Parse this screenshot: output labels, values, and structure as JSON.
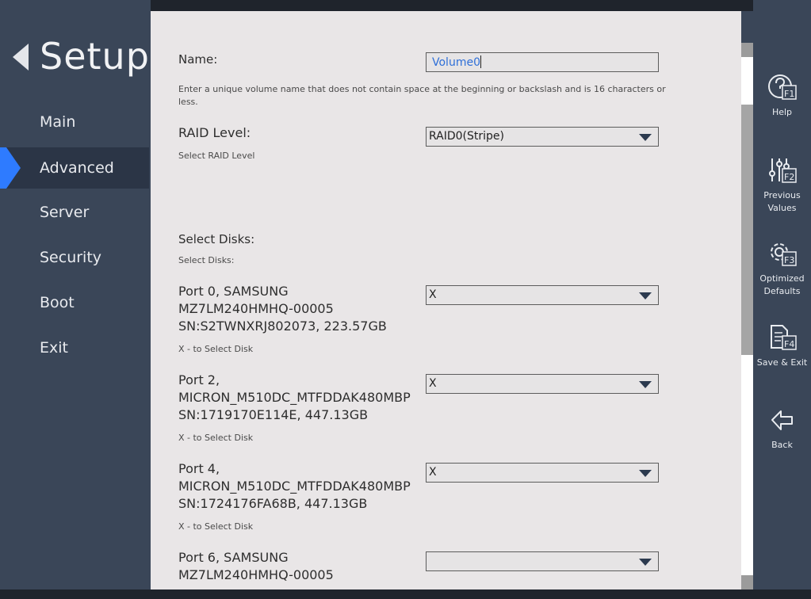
{
  "nav": {
    "title": "Setup",
    "items": [
      {
        "label": "Main"
      },
      {
        "label": "Advanced"
      },
      {
        "label": "Server"
      },
      {
        "label": "Security"
      },
      {
        "label": "Boot"
      },
      {
        "label": "Exit"
      }
    ],
    "active": "Advanced",
    "accent_color": "#2e7bff"
  },
  "form": {
    "name_label": "Name:",
    "name_value": "Volume0",
    "name_help": "Enter a unique volume name that does not contain space at the beginning or backslash and is 16 characters or less.",
    "raid_label": "RAID Level:",
    "raid_value": "RAID0(Stripe)",
    "raid_help": "Select RAID Level",
    "disks_label": "Select Disks:",
    "disks_help": "Select Disks:",
    "disks": [
      {
        "line1": "Port 0, SAMSUNG",
        "line2": "MZ7LM240HMHQ-00005",
        "line3": "SN:S2TWNXRJ802073, 223.57GB",
        "value": "X",
        "help": "X - to Select Disk"
      },
      {
        "line1": "Port 2,",
        "line2": "MICRON_M510DC_MTFDDAK480MBP",
        "line3": "SN:1719170E114E, 447.13GB",
        "value": "X",
        "help": "X - to Select Disk"
      },
      {
        "line1": "Port 4,",
        "line2": "MICRON_M510DC_MTFDDAK480MBP",
        "line3": "SN:1724176FA68B, 447.13GB",
        "value": "X",
        "help": "X - to Select Disk"
      },
      {
        "line1": "Port 6, SAMSUNG",
        "line2": "MZ7LM240HMHQ-00005",
        "line3": "",
        "value": "",
        "help": ""
      }
    ]
  },
  "toolbar": {
    "help": {
      "label": "Help",
      "key": "F1"
    },
    "previous": {
      "label": "Previous Values",
      "key": "F2"
    },
    "optimized": {
      "label": "Optimized Defaults",
      "key": "F3"
    },
    "save_exit": {
      "label": "Save & Exit",
      "key": "F4"
    },
    "back": {
      "label": "Back"
    }
  }
}
